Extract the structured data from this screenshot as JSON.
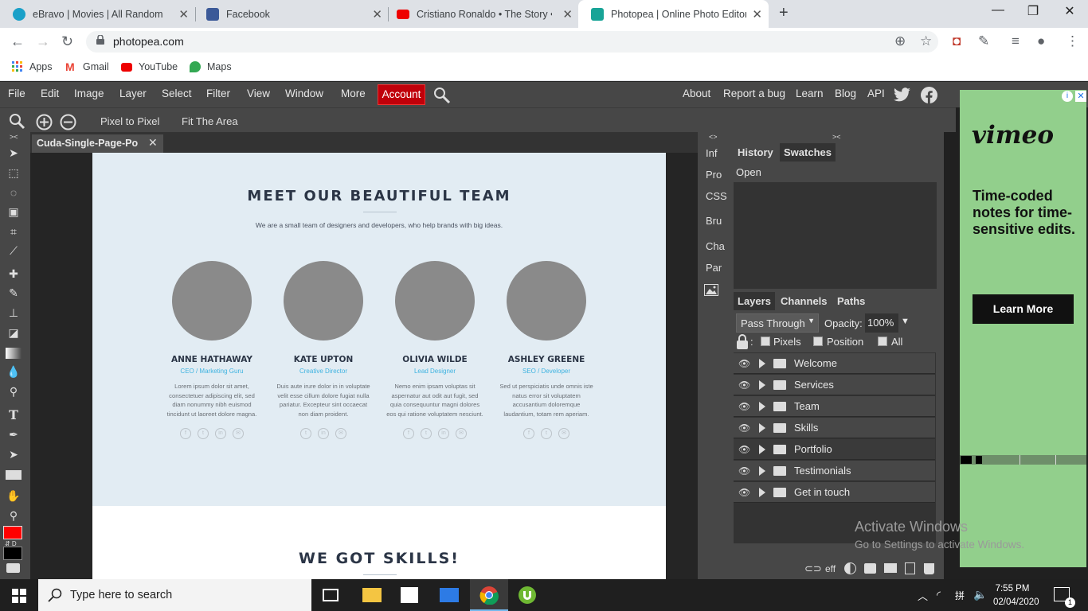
{
  "browser": {
    "tabs": [
      {
        "title": "eBravo | Movies | All Random",
        "fav_color": "#1aa0c8"
      },
      {
        "title": "Facebook",
        "fav_color": "#3b5998"
      },
      {
        "title": "Cristiano Ronaldo • The Story • 2",
        "fav_color": "#e00"
      },
      {
        "title": "Photopea | Online Photo Editor",
        "fav_color": "#18a497"
      }
    ],
    "url": "photopea.com",
    "bookmarks": [
      "Apps",
      "Gmail",
      "YouTube",
      "Maps"
    ]
  },
  "menu": {
    "items": [
      "File",
      "Edit",
      "Image",
      "Layer",
      "Select",
      "Filter",
      "View",
      "Window",
      "More"
    ],
    "account": "Account",
    "right": [
      "About",
      "Report a bug",
      "Learn",
      "Blog",
      "API"
    ]
  },
  "options": {
    "pixel_to_pixel": "Pixel to Pixel",
    "fit_area": "Fit The Area"
  },
  "document": {
    "tab": "Cuda-Single-Page-Po",
    "heading": "MEET OUR BEAUTIFUL TEAM",
    "subtitle": "We are a small team of designers and developers, who help brands with big ideas.",
    "members": [
      {
        "name": "ANNE HATHAWAY",
        "role": "CEO / Marketing Guru",
        "bio": "Lorem ipsum dolor sit amet, consectetuer adipiscing elit, sed diam nonummy nibh euismod tincidunt ut laoreet dolore magna."
      },
      {
        "name": "KATE UPTON",
        "role": "Creative Director",
        "bio": "Duis aute irure dolor in in voluptate velit esse cillum dolore fugiat nulla pariatur. Excepteur sint occaecat non diam proident."
      },
      {
        "name": "OLIVIA WILDE",
        "role": "Lead Designer",
        "bio": "Nemo enim ipsam voluptas sit aspernatur aut odit aut fugit, sed quia consequuntur magni dolores eos qui ratione voluptatem nesciunt."
      },
      {
        "name": "ASHLEY GREENE",
        "role": "SEO / Developer",
        "bio": "Sed ut perspiciatis unde omnis iste natus error sit voluptatem accusantium doloremque laudantium, totam rem aperiam."
      }
    ],
    "heading2": "WE GOT SKILLS!"
  },
  "collapsed_panels": [
    "Inf",
    "Pro",
    "CSS",
    "Bru",
    "Cha",
    "Par"
  ],
  "history": {
    "tabs": [
      "History",
      "Swatches"
    ],
    "items": [
      "Open"
    ]
  },
  "layers_panel": {
    "tabs": [
      "Layers",
      "Channels",
      "Paths"
    ],
    "blend_mode": "Pass Through",
    "opacity_label": "Opacity:",
    "opacity": "100%",
    "lock_label": ":",
    "lock_options": [
      "Pixels",
      "Position",
      "All"
    ],
    "layers": [
      "Welcome",
      "Services",
      "Team",
      "Skills",
      "Portfolio",
      "Testimonials",
      "Get in touch"
    ],
    "selected": "Portfolio",
    "footer_eff": "eff"
  },
  "ad": {
    "brand": "vimeo",
    "text": "Time-coded notes for time-sensitive edits.",
    "cta": "Learn More"
  },
  "watermark": {
    "line1": "Activate Windows",
    "line2": "Go to Settings to activate Windows."
  },
  "taskbar": {
    "search_placeholder": "Type here to search",
    "time": "7:55 PM",
    "date": "02/04/2020",
    "notif_count": "1"
  }
}
